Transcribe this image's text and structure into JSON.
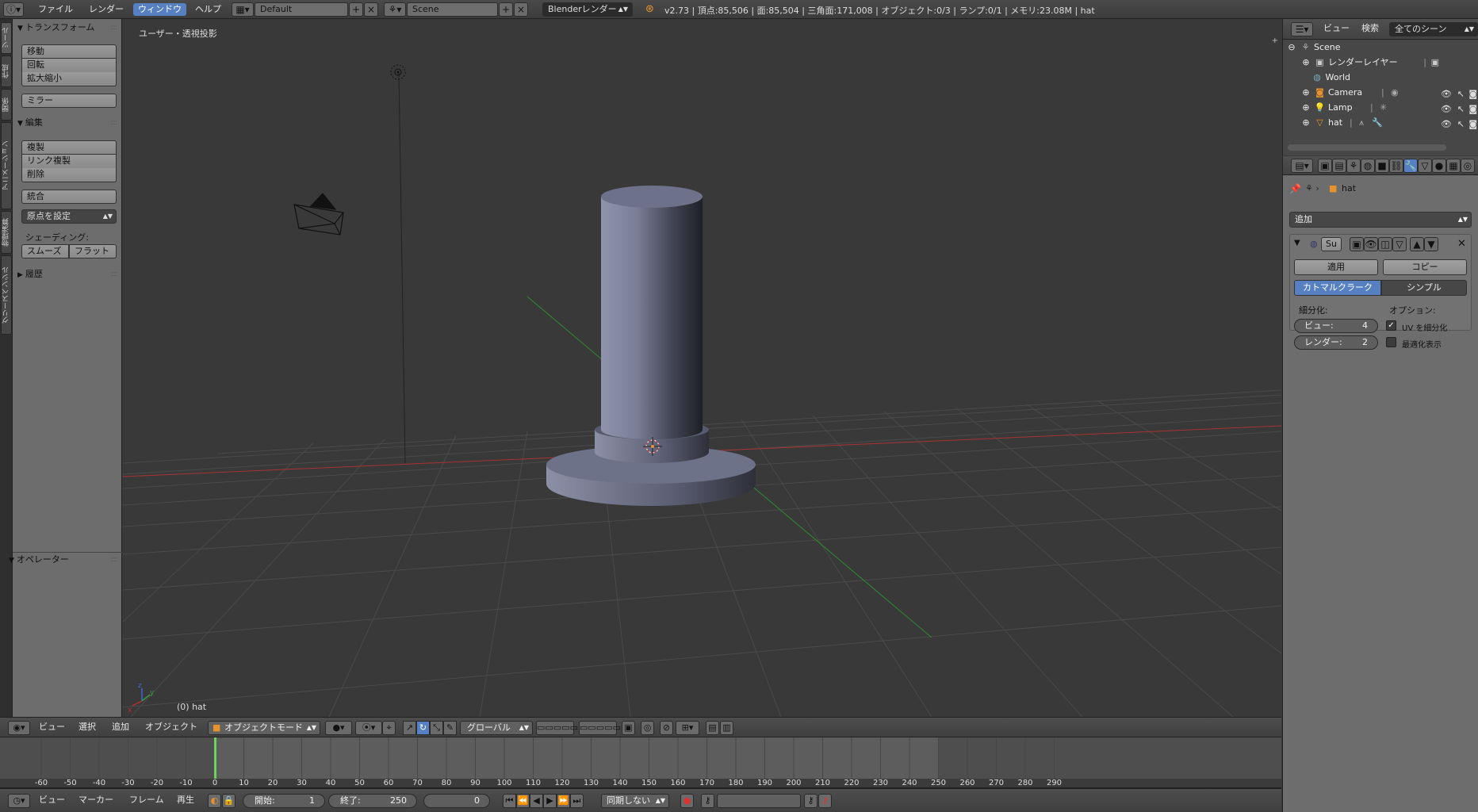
{
  "topbar": {
    "menus": [
      "ファイル",
      "レンダー",
      "ウィンドウ",
      "ヘルプ"
    ],
    "layout": "Default",
    "scene": "Scene",
    "engine": "Blenderレンダー",
    "stats": "v2.73 | 頂点:85,506 | 面:85,504 | 三角面:171,008 | オブジェクト:0/3 | ランプ:0/1 | メモリ:23.08M | hat"
  },
  "left_tabs": [
    "ツール",
    "作成",
    "関係",
    "アニメーション",
    "物理演算",
    "グリースペンシル"
  ],
  "toolshelf": {
    "transform": {
      "title": "トランスフォーム",
      "buttons": [
        "移動",
        "回転",
        "拡大縮小"
      ],
      "mirror": "ミラー"
    },
    "edit": {
      "title": "編集",
      "buttons": [
        "複製",
        "リンク複製",
        "削除"
      ],
      "join": "統合",
      "set_origin": "原点を設定",
      "shading_label": "シェーディング:",
      "smooth": "スムーズ",
      "flat": "フラット"
    },
    "history": "履歴",
    "operator": "オペレーター"
  },
  "viewport": {
    "title": "ユーザー・透視投影",
    "object_label": "(0) hat"
  },
  "view_header": {
    "menus": [
      "ビュー",
      "選択",
      "追加",
      "オブジェクト"
    ],
    "mode": "オブジェクトモード",
    "orientation": "グローバル"
  },
  "timeline": {
    "ticks": [
      -60,
      -50,
      -40,
      -30,
      -20,
      -10,
      0,
      10,
      20,
      30,
      40,
      50,
      60,
      70,
      80,
      90,
      100,
      110,
      120,
      130,
      140,
      150,
      160,
      170,
      180,
      190,
      200,
      210,
      220,
      230,
      240,
      250,
      260,
      270,
      280,
      290
    ],
    "menus": [
      "ビュー",
      "マーカー",
      "フレーム",
      "再生"
    ],
    "start_label": "開始:",
    "start": "1",
    "end_label": "終了:",
    "end": "250",
    "current": "0",
    "sync": "同期しない",
    "current_frame": 0,
    "range_end": 250
  },
  "outliner": {
    "menus": [
      "ビュー",
      "検索"
    ],
    "scenes_select": "全てのシーン",
    "items": [
      {
        "name": "Scene",
        "indent": 0,
        "icon": "scene-icon"
      },
      {
        "name": "レンダーレイヤー",
        "indent": 1,
        "icon": "render-layer-icon"
      },
      {
        "name": "World",
        "indent": 1,
        "icon": "world-icon"
      },
      {
        "name": "Camera",
        "indent": 1,
        "icon": "camera-icon"
      },
      {
        "name": "Lamp",
        "indent": 1,
        "icon": "lamp-icon"
      },
      {
        "name": "hat",
        "indent": 1,
        "icon": "mesh-icon"
      }
    ]
  },
  "properties": {
    "object_name": "hat",
    "add_modifier": "追加",
    "modifier_short": "Su",
    "apply": "適用",
    "copy": "コピー",
    "catmull": "カトマルクラーク",
    "simple": "シンプル",
    "subdiv_label": "細分化:",
    "options_label": "オプション:",
    "view_label": "ビュー:",
    "view_value": "4",
    "render_label": "レンダー:",
    "render_value": "2",
    "uv_subdiv": "UV を細分化",
    "optimal_display": "最適化表示"
  },
  "colors": {
    "accent": "#5680c2",
    "timeline_cursor": "#6fd35a",
    "x_axis": "#b03030",
    "y_axis": "#3a9a3a"
  }
}
